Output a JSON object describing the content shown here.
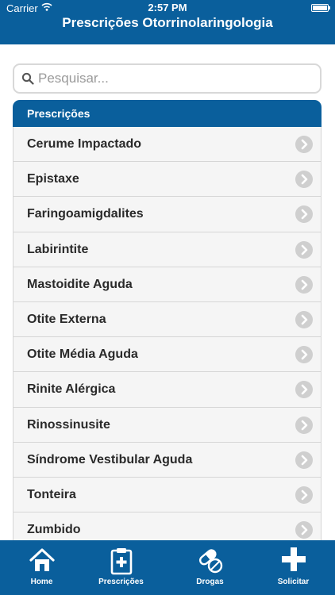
{
  "status": {
    "carrier": "Carrier",
    "time": "2:57 PM"
  },
  "header": {
    "title": "Prescrições Otorrinolaringologia"
  },
  "search": {
    "placeholder": "Pesquisar..."
  },
  "section": {
    "title": "Prescrições"
  },
  "items": [
    {
      "label": "Cerume Impactado"
    },
    {
      "label": "Epistaxe"
    },
    {
      "label": "Faringoamigdalites"
    },
    {
      "label": "Labirintite"
    },
    {
      "label": "Mastoidite Aguda"
    },
    {
      "label": "Otite Externa"
    },
    {
      "label": "Otite Média Aguda"
    },
    {
      "label": "Rinite Alérgica"
    },
    {
      "label": "Rinossinusite"
    },
    {
      "label": "Síndrome Vestibular Aguda"
    },
    {
      "label": "Tonteira"
    },
    {
      "label": "Zumbido"
    }
  ],
  "tabs": [
    {
      "label": "Home",
      "icon": "home-icon"
    },
    {
      "label": "Prescrições",
      "icon": "clipboard-icon"
    },
    {
      "label": "Drogas",
      "icon": "pills-icon"
    },
    {
      "label": "Solicitar",
      "icon": "plus-icon"
    }
  ],
  "colors": {
    "brand": "#0a5f9c",
    "row_bg": "#f5f5f5",
    "chevron": "#cfcfcf"
  }
}
